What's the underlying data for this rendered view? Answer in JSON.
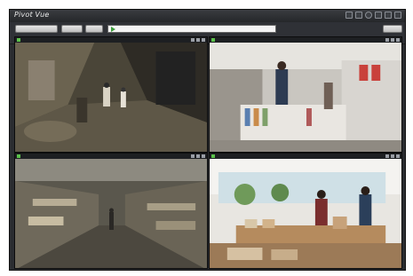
{
  "window": {
    "title": "Pivot Vue"
  },
  "toolbar": {
    "buttons": [
      "",
      "",
      "",
      ""
    ],
    "search_value": ""
  },
  "cameras": [
    {
      "label": ""
    },
    {
      "label": ""
    },
    {
      "label": ""
    },
    {
      "label": ""
    }
  ],
  "colors": {
    "accent_green": "#5bc24b",
    "frame": "#2b2d31"
  },
  "icons": [
    "minimize-icon",
    "maximize-icon",
    "close-icon",
    "settings-icon",
    "layout-icon",
    "play-icon"
  ]
}
